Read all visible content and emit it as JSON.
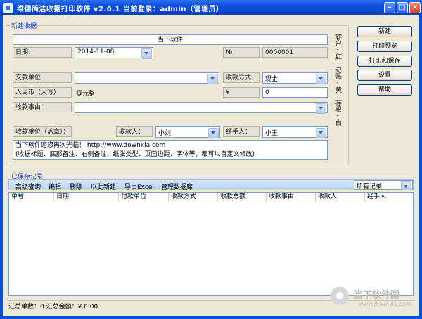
{
  "window": {
    "title": "维德简洁收据打印软件 v2.0.1        当前登录：admin（管理员）",
    "controls": {
      "minimize": "–",
      "maximize": "□",
      "close": "×"
    }
  },
  "new_receipt": {
    "group_title": "新建收据",
    "header_title": "当下软件",
    "date_label": "日期：",
    "date_value": "2014-11-08",
    "no_label": "№",
    "no_value": "0000001",
    "payer_label": "交款单位",
    "payer_value": "",
    "method_label": "收款方式",
    "method_value": "现金",
    "rmb_label": "人民币（大写）",
    "rmb_value": "零元整",
    "yen_label": "¥",
    "yen_value": "0",
    "reason_label": "收款事由",
    "reason_value": "",
    "unit_label": "收款单位（盖章）：",
    "receiver_label": "收款人：",
    "receiver_value": "小刘",
    "handler_label": "经手人：",
    "handler_value": "小王",
    "note_line1": "当下软件迎您再次光临！ http://www.downxia.com",
    "note_line2": "(收据标题、底部备注、右侧备注、纸张类型、页面边距、字体等，都可以自定义修改)",
    "side_note": "客户-红-记账-黄-存根-白"
  },
  "actions": {
    "new": "新建",
    "print_preview": "打印预览",
    "print_save": "打印和保存",
    "settings": "设置",
    "help": "帮助"
  },
  "saved_records": {
    "group_title": "已保存记录",
    "toolbar": [
      "高级查询",
      "编辑",
      "删除",
      "以此新建",
      "导出Excel",
      "管理数据库"
    ],
    "filter_value": "所有记录",
    "columns": [
      "单号",
      "日期",
      "付款单位",
      "收款方式",
      "收款总额",
      "收款事由",
      "收款人",
      "经手人"
    ],
    "rows": []
  },
  "status": {
    "summary": "汇总单数：0   汇总金额：¥ 0.00"
  },
  "watermark": {
    "text": "当下软件园",
    "url": "www.downxia.com"
  }
}
